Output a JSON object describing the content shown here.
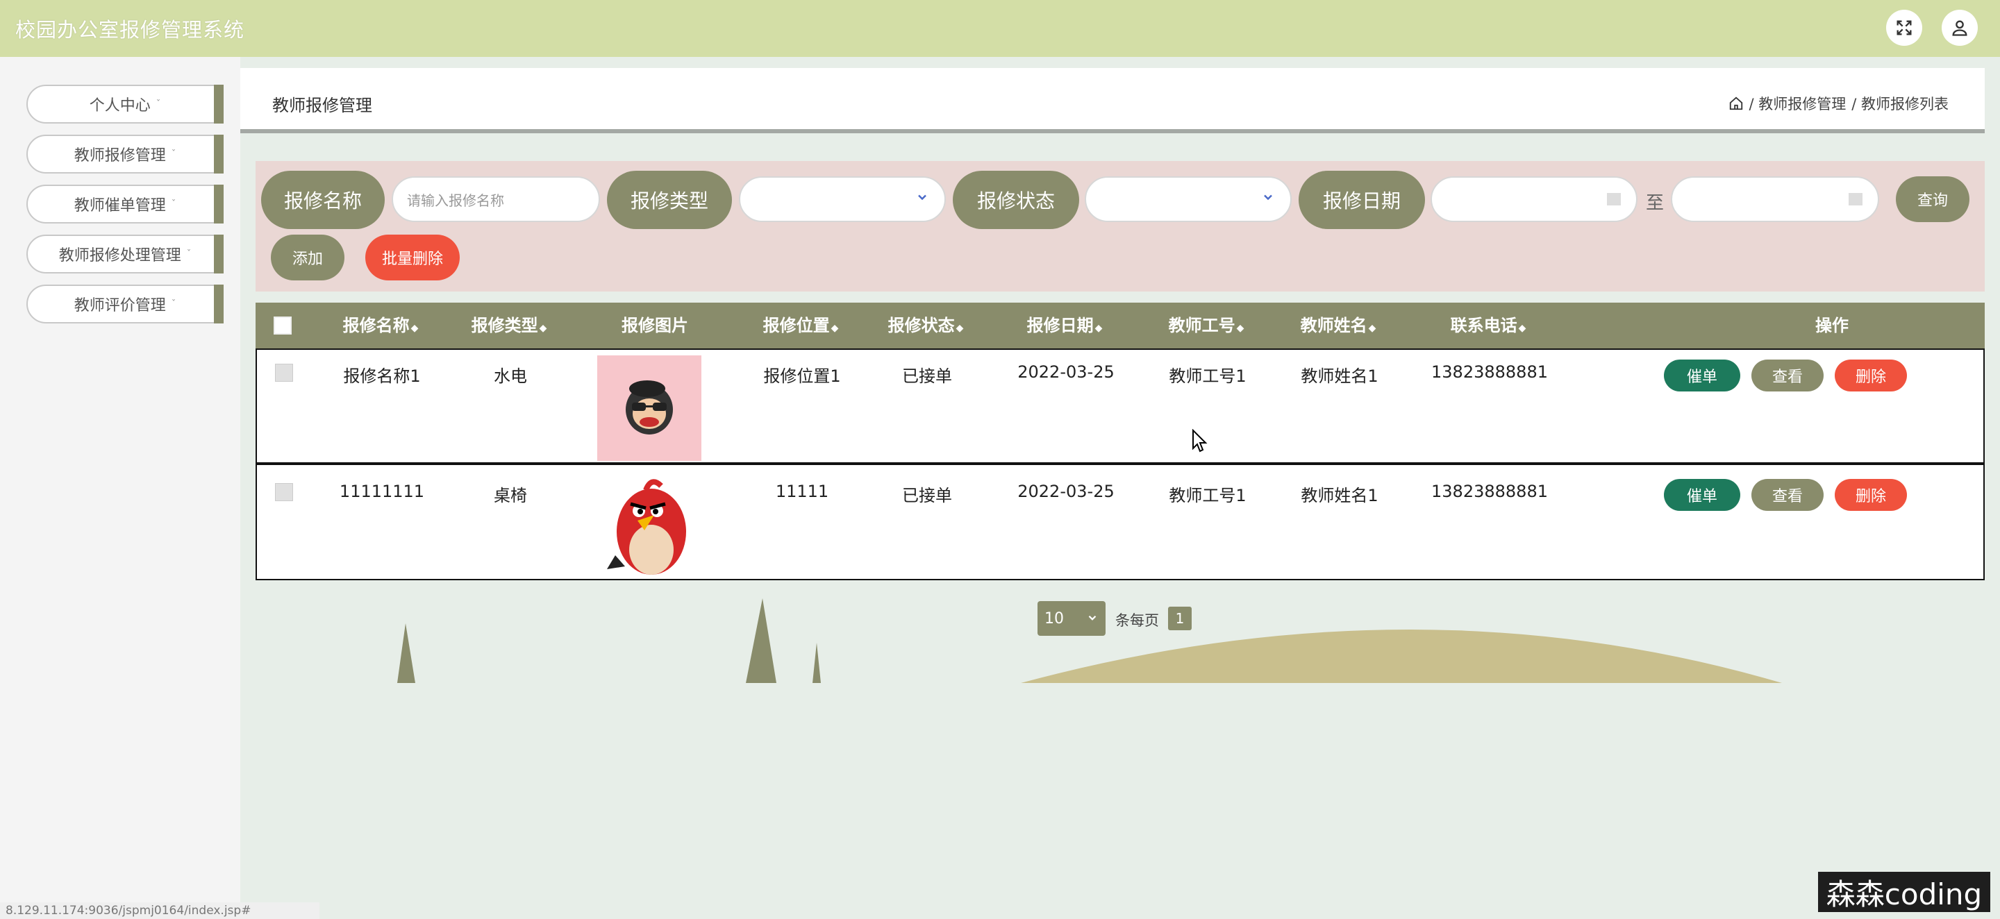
{
  "app_title": "校园办公室报修管理系统",
  "header_icons": [
    "fullscreen-icon",
    "user-icon"
  ],
  "sidebar": {
    "items": [
      {
        "label": "个人中心"
      },
      {
        "label": "教师报修管理"
      },
      {
        "label": "教师催单管理"
      },
      {
        "label": "教师报修处理管理"
      },
      {
        "label": "教师评价管理"
      }
    ],
    "caret": "ˇ"
  },
  "panel": {
    "title": "教师报修管理",
    "breadcrumb": [
      "/ 教师报修管理",
      "/ 教师报修列表"
    ]
  },
  "search": {
    "name_label": "报修名称",
    "name_placeholder": "请输入报修名称",
    "type_label": "报修类型",
    "status_label": "报修状态",
    "date_label": "报修日期",
    "to": "至",
    "query": "查询",
    "add": "添加",
    "batch_delete": "批量删除"
  },
  "table": {
    "headers": [
      "报修名称",
      "报修类型",
      "报修图片",
      "报修位置",
      "报修状态",
      "报修日期",
      "教师工号",
      "教师姓名",
      "联系电话",
      "操作"
    ],
    "sort_glyph": "◆",
    "rows": [
      {
        "name": "报修名称1",
        "type": "水电",
        "image": "monkey-picture",
        "location": "报修位置1",
        "status": "已接单",
        "date": "2022-03-25",
        "teacher_id": "教师工号1",
        "teacher_name": "教师姓名1",
        "phone": "13823888881"
      },
      {
        "name": "11111111",
        "type": "桌椅",
        "image": "red-bird-picture",
        "location": "11111",
        "status": "已接单",
        "date": "2022-03-25",
        "teacher_id": "教师工号1",
        "teacher_name": "教师姓名1",
        "phone": "13823888881"
      }
    ],
    "actions": {
      "urge": "催单",
      "view": "查看",
      "delete": "删除"
    }
  },
  "pagination": {
    "page_size": "10",
    "per_page": "条每页",
    "current": "1"
  },
  "statusbar": "8.129.11.174:9036/jspmj0164/index.jsp#",
  "watermark": "森森coding",
  "colors": {
    "topbar": "#d3dea6",
    "accent": "#898c6b",
    "danger": "#f0523d",
    "teal": "#1d7a5c",
    "search_bg": "#ead7d4"
  }
}
